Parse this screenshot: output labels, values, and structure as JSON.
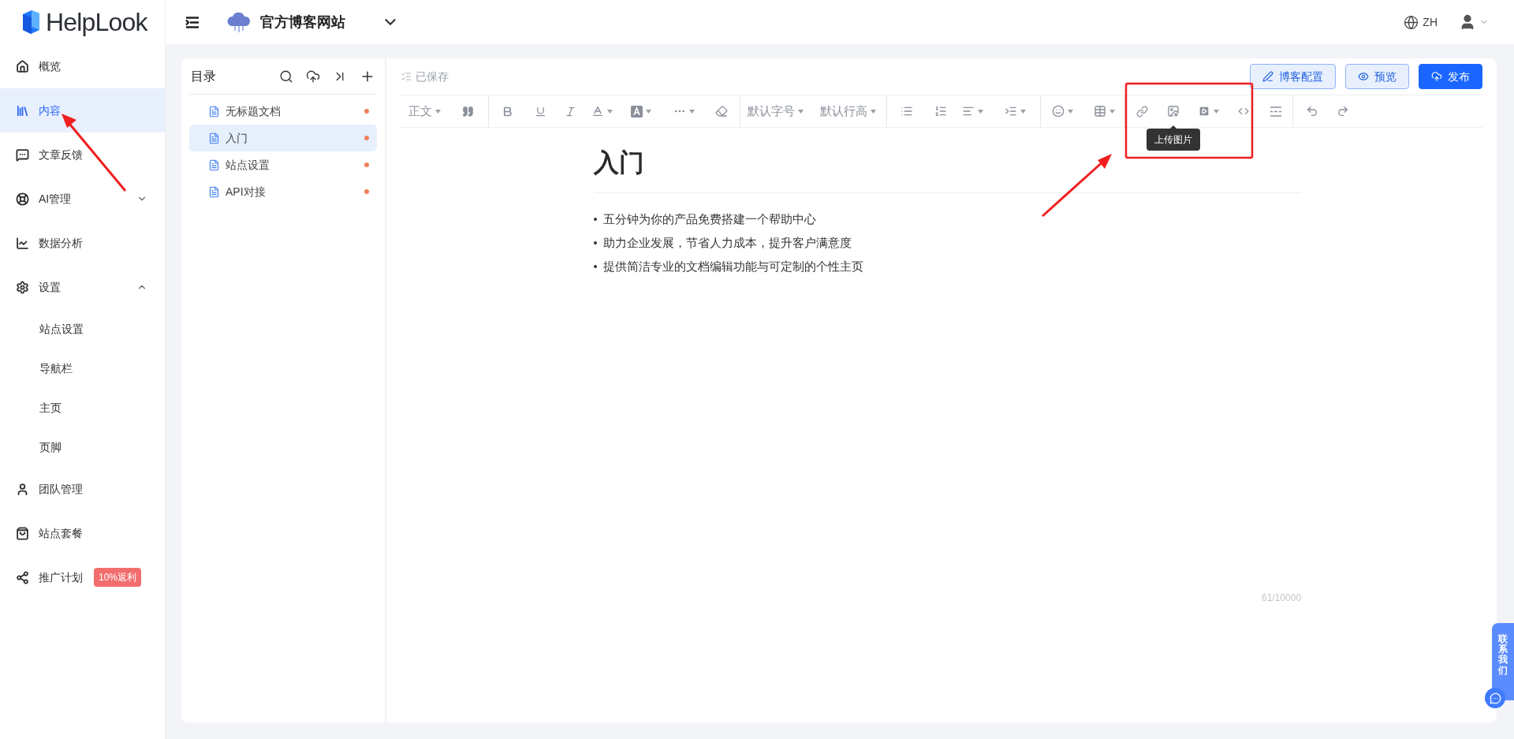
{
  "header": {
    "logo": "HelpLook",
    "site_name": "官方博客网站",
    "language": "ZH"
  },
  "sidebar": {
    "items": [
      {
        "label": "概览",
        "selected": false
      },
      {
        "label": "内容",
        "selected": true
      },
      {
        "label": "文章反馈",
        "selected": false
      },
      {
        "label": "AI管理",
        "selected": false,
        "expanded": false
      },
      {
        "label": "数据分析",
        "selected": false
      },
      {
        "label": "设置",
        "selected": false,
        "expanded": true,
        "children": [
          {
            "label": "站点设置",
            "selected": false
          },
          {
            "label": "导航栏",
            "selected": false
          },
          {
            "label": "主页",
            "selected": false
          },
          {
            "label": "页脚",
            "selected": false
          }
        ]
      },
      {
        "label": "团队管理",
        "selected": false
      },
      {
        "label": "站点套餐",
        "selected": false
      },
      {
        "label": "推广计划",
        "selected": false,
        "badge": "10%返利"
      }
    ]
  },
  "catalog": {
    "title": "目录",
    "documents": [
      {
        "title": "无标题文档",
        "selected": false,
        "unsaved": true
      },
      {
        "title": "入门",
        "selected": true,
        "unsaved": true
      },
      {
        "title": "站点设置",
        "selected": false,
        "unsaved": true
      },
      {
        "title": "API对接",
        "selected": false,
        "unsaved": true
      }
    ]
  },
  "editor": {
    "save_status": "已保存",
    "buttons": [
      "博客配置",
      "预览",
      "发布"
    ],
    "toolbar": {
      "paragraph_style": "正文",
      "font_size": "默认字号",
      "line_height": "默认行高",
      "tooltip": "上传图片"
    },
    "document": {
      "title": "入门",
      "bullets": [
        "五分钟为你的产品免费搭建一个帮助中心",
        "助力企业发展，节省人力成本，提升客户满意度",
        "提供简洁专业的文档编辑功能与可定制的个性主页"
      ]
    },
    "word_count": "61/10000"
  },
  "contact_tab": {
    "label": "联系我们"
  }
}
